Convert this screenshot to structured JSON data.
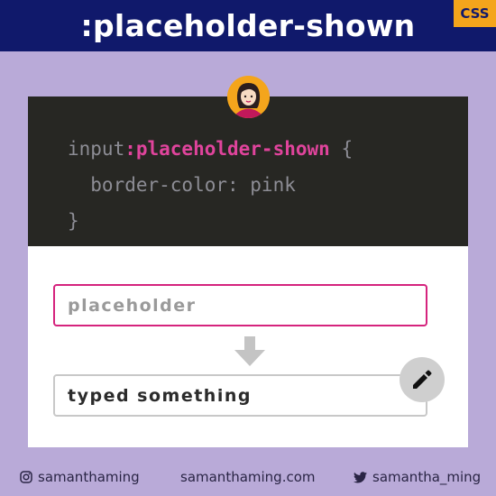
{
  "header": {
    "title": ":placeholder-shown",
    "badge": "CSS"
  },
  "code": {
    "line1_prefix": "input",
    "line1_selector": ":placeholder-shown",
    "line1_suffix": " {",
    "line2": "  border-color: pink",
    "line3": "}"
  },
  "demo": {
    "placeholder_text": "placeholder",
    "typed_text": "typed something"
  },
  "footer": {
    "instagram": "samanthaming",
    "website": "samanthaming.com",
    "twitter": "samantha_ming"
  },
  "colors": {
    "background": "#b9aad8",
    "header": "#10196b",
    "badge": "#f4a51c",
    "code_bg": "#272723",
    "selector": "#e0449c",
    "pink_border": "#d5237d"
  },
  "icons": [
    "avatar",
    "down-arrow-icon",
    "pencil-icon",
    "instagram-icon",
    "twitter-icon"
  ]
}
